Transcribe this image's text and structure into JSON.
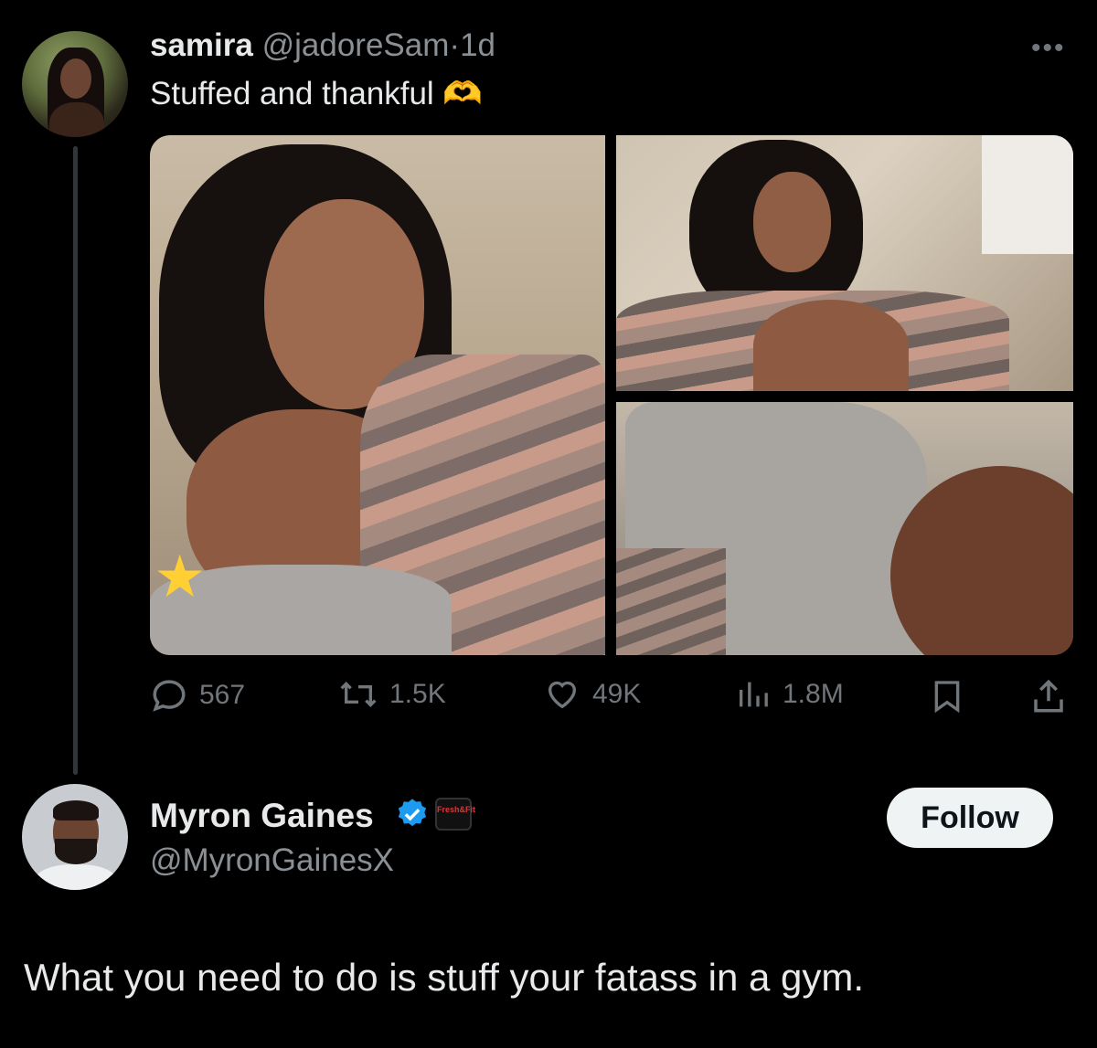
{
  "original_tweet": {
    "display_name": "samira",
    "handle": "@jadoreSam",
    "separator": "·",
    "timestamp": "1d",
    "text": "Stuffed and thankful 🫶",
    "more_icon": "more-horizontal-icon",
    "media_count": 3,
    "stats": {
      "replies": "567",
      "reposts": "1.5K",
      "likes": "49K",
      "views": "1.8M"
    }
  },
  "reply": {
    "display_name": "Myron Gaines",
    "handle": "@MyronGainesX",
    "verified": true,
    "affiliate_badge": "Fresh&Fit",
    "follow_label": "Follow",
    "text": "What you need to do is stuff your fatass in a gym."
  },
  "colors": {
    "background": "#000000",
    "text": "#e7e9ea",
    "muted": "#71767b",
    "verified_blue": "#1d9bf0",
    "follow_bg": "#eff3f4"
  }
}
